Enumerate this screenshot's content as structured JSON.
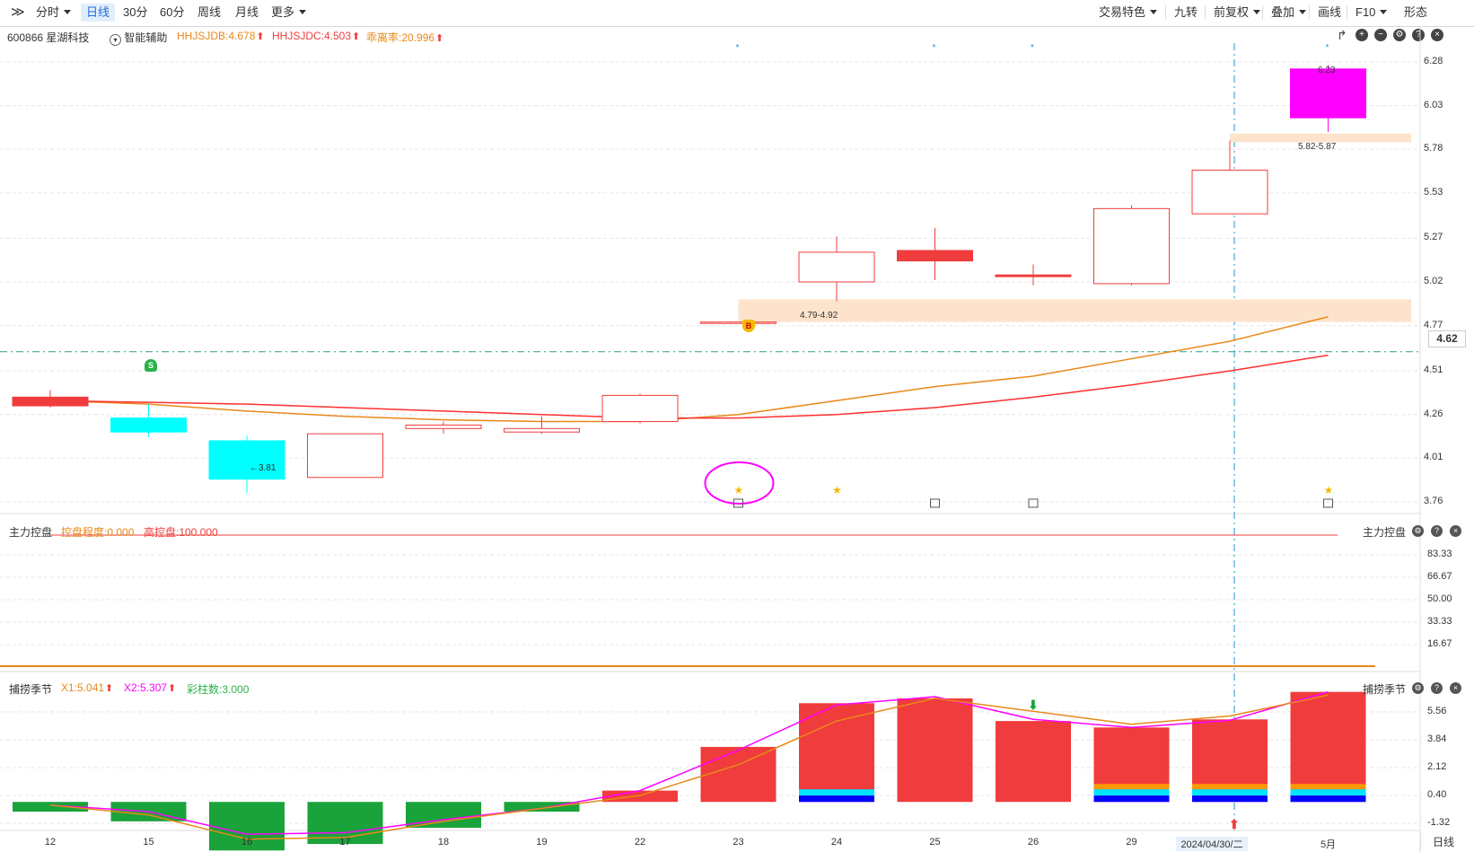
{
  "toolbar": {
    "expand": "≫",
    "left": [
      "分时",
      "日线",
      "30分",
      "60分",
      "周线",
      "月线",
      "更多"
    ],
    "right": [
      "交易特色",
      "九转",
      "前复权",
      "叠加",
      "画线",
      "F10",
      "形态"
    ]
  },
  "stock": {
    "code_name": "600866 星湖科技",
    "assist": "智能辅助",
    "ind1": "HHJSJDB:4.678",
    "ind2": "HHJSJDC:4.503",
    "ind3": "乖离率:20.996",
    "up_arrow": "⬆",
    "current_price": "4.62",
    "low_mark": "←3.81",
    "high_mark": "6.23",
    "zone1_label": "4.79-4.92",
    "zone2_label": "5.82-5.87",
    "buy_mark": "B",
    "sell_mark": "S"
  },
  "price_axis": [
    "6.28",
    "6.03",
    "5.78",
    "5.53",
    "5.27",
    "5.02",
    "4.77",
    "4.51",
    "4.26",
    "4.01",
    "3.76"
  ],
  "panel2": {
    "title": "主力控盘",
    "ind1": "控盘程度:0.000",
    "ind2": "高控盘:100.000",
    "right_title": "主力控盘",
    "axis": [
      "83.33",
      "66.67",
      "50.00",
      "33.33",
      "16.67"
    ]
  },
  "panel3": {
    "title": "捕捞季节",
    "ind1": "X1:5.041",
    "ind2": "X2:5.307",
    "ind3": "彩柱数:3.000",
    "right_title": "捕捞季节",
    "axis": [
      "5.56",
      "3.84",
      "2.12",
      "0.40",
      "-1.32"
    ]
  },
  "x_axis": [
    "12",
    "15",
    "16",
    "17",
    "18",
    "19",
    "22",
    "23",
    "24",
    "25",
    "26",
    "29",
    "2024/04/30/二",
    "5月"
  ],
  "period_label": "日线",
  "colors": {
    "up": "#f03c3c",
    "down": "#00ffff",
    "accent": "#1a6ee0",
    "ma1": "#ff3030",
    "ma2": "#e8891a",
    "hl": "#ff00ff"
  },
  "chart_data": [
    {
      "type": "candlestick",
      "x": [
        "04-12",
        "04-15",
        "04-16",
        "04-17",
        "04-18",
        "04-19",
        "04-22",
        "04-23",
        "04-24",
        "04-25",
        "04-26",
        "04-29",
        "04-30",
        "05-06"
      ],
      "open": [
        4.31,
        4.24,
        4.11,
        3.9,
        4.18,
        4.16,
        4.22,
        4.79,
        5.02,
        5.14,
        5.06,
        5.01,
        5.41,
        5.96
      ],
      "close": [
        4.36,
        4.16,
        3.89,
        4.15,
        4.2,
        4.18,
        4.37,
        4.79,
        5.19,
        5.2,
        5.05,
        5.44,
        5.66,
        6.24
      ],
      "high": [
        4.4,
        4.32,
        4.14,
        4.15,
        4.22,
        4.25,
        4.38,
        4.79,
        5.28,
        5.33,
        5.12,
        5.46,
        5.83,
        6.26
      ],
      "low": [
        4.3,
        4.13,
        3.81,
        3.9,
        4.15,
        4.15,
        4.21,
        4.79,
        4.91,
        5.03,
        5.0,
        5.0,
        5.41,
        5.88
      ],
      "series": [
        {
          "name": "HHJSJDB",
          "values": [
            4.34,
            4.32,
            4.28,
            4.25,
            4.23,
            4.22,
            4.22,
            4.26,
            4.34,
            4.42,
            4.48,
            4.58,
            4.68,
            4.82
          ]
        },
        {
          "name": "HHJSJDC",
          "values": [
            4.34,
            4.33,
            4.32,
            4.3,
            4.28,
            4.26,
            4.24,
            4.24,
            4.26,
            4.3,
            4.36,
            4.43,
            4.51,
            4.6
          ]
        }
      ]
    },
    {
      "type": "bar",
      "title": "捕捞季节",
      "x": [
        "04-12",
        "04-15",
        "04-16",
        "04-17",
        "04-18",
        "04-19",
        "04-22",
        "04-23",
        "04-24",
        "04-25",
        "04-26",
        "04-29",
        "04-30",
        "05-06"
      ],
      "series": [
        {
          "name": "X1",
          "values": [
            -0.2,
            -0.6,
            -2.0,
            -1.9,
            -1.1,
            -0.4,
            0.7,
            3.2,
            6.0,
            6.5,
            5.1,
            4.6,
            5.04,
            6.8
          ]
        },
        {
          "name": "X2",
          "values": [
            -0.2,
            -0.8,
            -2.3,
            -2.2,
            -1.2,
            -0.4,
            0.4,
            2.3,
            5.0,
            6.4,
            5.6,
            4.8,
            5.31,
            6.6
          ]
        }
      ],
      "bars": [
        -0.6,
        -1.2,
        -3.0,
        -2.6,
        -1.6,
        -0.6,
        0.7,
        3.4,
        6.1,
        6.4,
        5.0,
        4.6,
        5.1,
        6.8
      ],
      "ylim": [
        -1.32,
        5.56
      ]
    }
  ]
}
